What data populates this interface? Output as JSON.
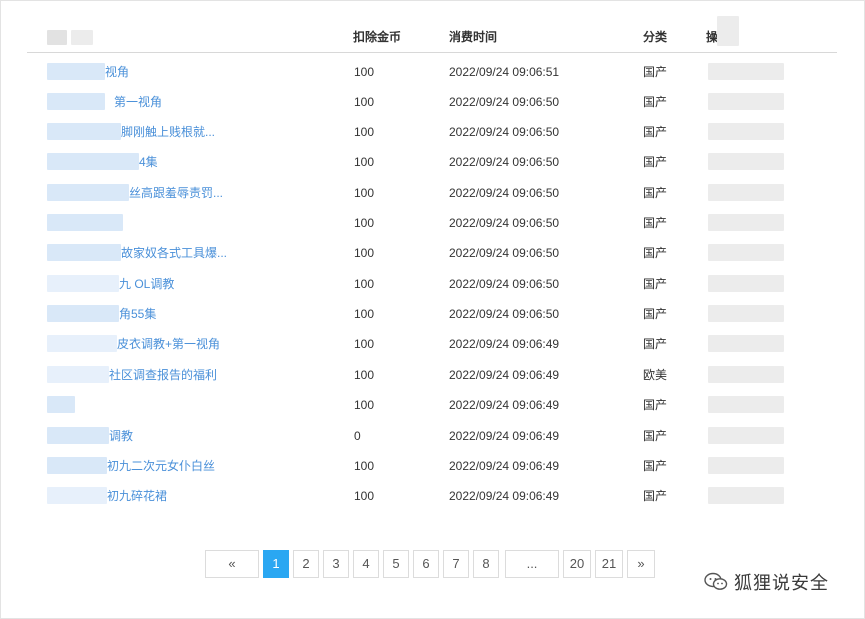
{
  "table": {
    "headers": {
      "col_coins": "扣除金币",
      "col_time": "消费时间",
      "col_category": "分类",
      "col_action": "操"
    },
    "rows": [
      {
        "title": "视角",
        "coins": "100",
        "time": "2022/09/24 09:06:51",
        "category": "国产"
      },
      {
        "title": "第一视角",
        "coins": "100",
        "time": "2022/09/24 09:06:50",
        "category": "国产"
      },
      {
        "title": "脚刚触上贱根就...",
        "coins": "100",
        "time": "2022/09/24 09:06:50",
        "category": "国产"
      },
      {
        "title": "4集",
        "coins": "100",
        "time": "2022/09/24 09:06:50",
        "category": "国产"
      },
      {
        "title": "丝高跟羞辱责罚...",
        "coins": "100",
        "time": "2022/09/24 09:06:50",
        "category": "国产"
      },
      {
        "title": "",
        "coins": "100",
        "time": "2022/09/24 09:06:50",
        "category": "国产"
      },
      {
        "title": "故家奴各式工具爆...",
        "coins": "100",
        "time": "2022/09/24 09:06:50",
        "category": "国产"
      },
      {
        "title": "九 OL调教",
        "coins": "100",
        "time": "2022/09/24 09:06:50",
        "category": "国产"
      },
      {
        "title": "角55集",
        "coins": "100",
        "time": "2022/09/24 09:06:50",
        "category": "国产"
      },
      {
        "title": "皮衣调教+第一视角",
        "coins": "100",
        "time": "2022/09/24 09:06:49",
        "category": "国产"
      },
      {
        "title": "社区调查报告的福利",
        "coins": "100",
        "time": "2022/09/24 09:06:49",
        "category": "欧美"
      },
      {
        "title": "",
        "coins": "100",
        "time": "2022/09/24 09:06:49",
        "category": "国产"
      },
      {
        "title": "调教",
        "coins": "0",
        "time": "2022/09/24 09:06:49",
        "category": "国产"
      },
      {
        "title": "初九二次元女仆白丝",
        "coins": "100",
        "time": "2022/09/24 09:06:49",
        "category": "国产"
      },
      {
        "title": "初九碎花裙",
        "coins": "100",
        "time": "2022/09/24 09:06:49",
        "category": "国产"
      }
    ]
  },
  "pagination": {
    "prev": "«",
    "pages": [
      "1",
      "2",
      "3",
      "4",
      "5",
      "6",
      "7",
      "8"
    ],
    "ellipsis": "...",
    "tail_pages": [
      "20",
      "21"
    ],
    "next": "»",
    "active": "1"
  },
  "watermark": {
    "text": "狐狸说安全",
    "icon": "wechat-icon"
  },
  "colors": {
    "link": "#4a90d9",
    "active_page": "#2aa7f2"
  }
}
